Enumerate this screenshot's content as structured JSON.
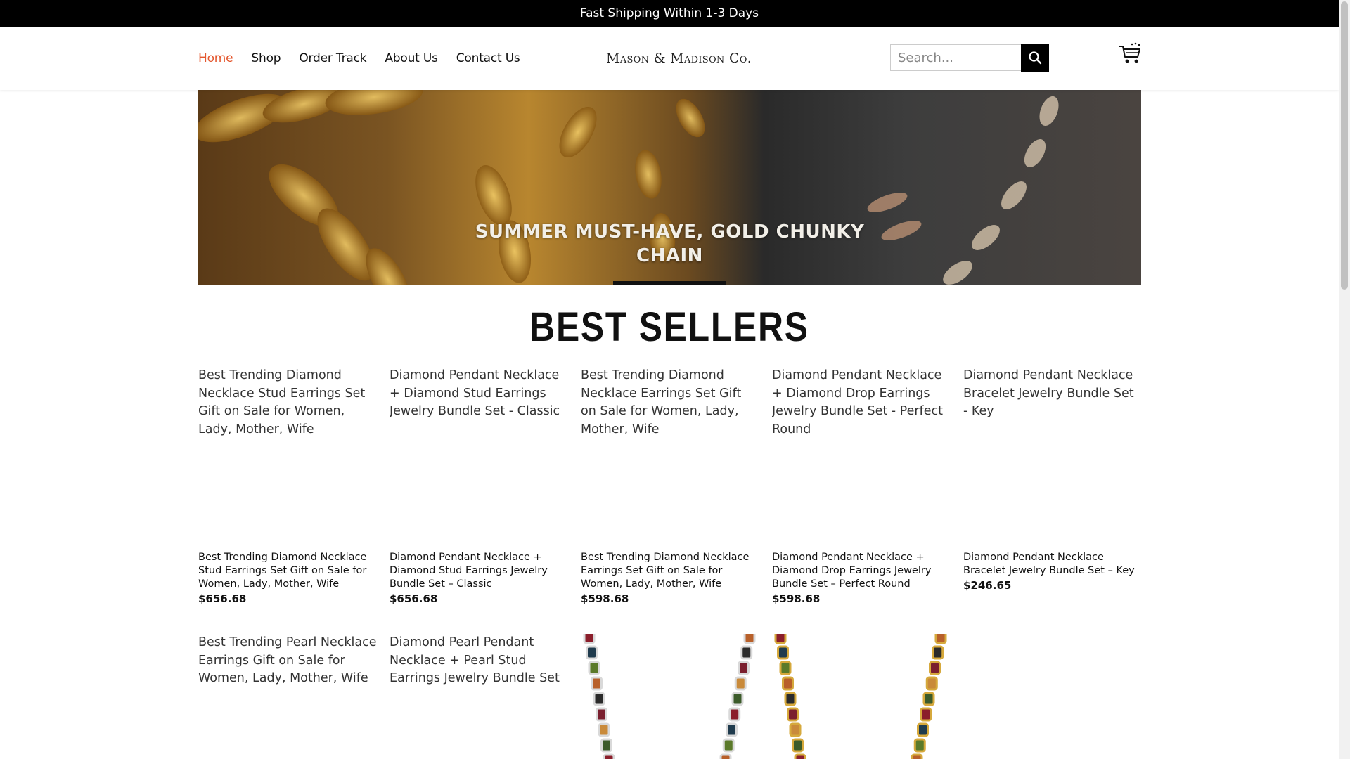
{
  "topbar": {
    "text": "Fast Shipping Within 1-3 Days"
  },
  "nav": {
    "items": [
      {
        "label": "Home",
        "active": true
      },
      {
        "label": "Shop"
      },
      {
        "label": "Order Track"
      },
      {
        "label": "About Us"
      },
      {
        "label": "Contact Us"
      }
    ]
  },
  "brand": {
    "logo": "Mason & Madison Co."
  },
  "search": {
    "placeholder": "Search...",
    "icon": "search-icon"
  },
  "cart": {
    "icon": "cart-icon"
  },
  "hero": {
    "line1": "SUMMER MUST-HAVE, GOLD CHUNKY",
    "line2": "CHAIN"
  },
  "section": {
    "title": "BEST SELLERS"
  },
  "products": [
    {
      "alt": "Best Trending Diamond Necklace Stud Earrings Set Gift on Sale for Women, Lady, Mother, Wife",
      "title": "Best Trending Diamond Necklace Stud Earrings Set Gift on Sale for Women, Lady, Mother, Wife",
      "price": "$656.68"
    },
    {
      "alt": "Diamond Pendant Necklace + Diamond Stud Earrings Jewelry Bundle Set - Classic",
      "title": "Diamond Pendant Necklace + Diamond Stud Earrings Jewelry Bundle Set – Classic",
      "price": "$656.68"
    },
    {
      "alt": "Best Trending Diamond Necklace Earrings Set Gift on Sale for Women, Lady, Mother, Wife",
      "title": "Best Trending Diamond Necklace Earrings Set Gift on Sale for Women, Lady, Mother, Wife",
      "price": "$598.68"
    },
    {
      "alt": "Diamond Pendant Necklace + Diamond Drop Earrings Jewelry Bundle Set - Perfect Round",
      "title": "Diamond Pendant Necklace + Diamond Drop Earrings Jewelry Bundle Set – Perfect Round",
      "price": "$598.68"
    },
    {
      "alt": "Diamond Pendant Necklace Bracelet Jewelry Bundle Set - Key",
      "title": "Diamond Pendant Necklace Bracelet Jewelry Bundle Set – Key",
      "price": "$246.65"
    }
  ],
  "products_row2": [
    {
      "alt": "Best Trending Pearl Necklace Earrings Gift on Sale for Women, Lady, Mother, Wife"
    },
    {
      "alt": "Diamond Pearl Pendant Necklace + Pearl Stud Earrings Jewelry Bundle Set"
    },
    {
      "image": "silver-gemstone-tennis-necklace"
    },
    {
      "image": "gold-gemstone-tennis-necklace"
    }
  ],
  "colors": {
    "accent": "#e4572e",
    "topbar": "#000000"
  }
}
